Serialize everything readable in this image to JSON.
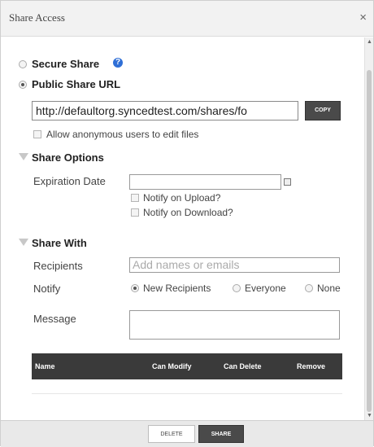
{
  "dialog": {
    "title": "Share Access",
    "close_glyph": "×"
  },
  "share_type": {
    "secure_label": "Secure Share",
    "public_label": "Public Share URL",
    "selected": "public"
  },
  "public_url": {
    "value": "http://defaultorg.syncedtest.com/shares/fo",
    "copy_label": "COPY",
    "anonymous_edit_label": "Allow anonymous users to edit files",
    "anonymous_edit_checked": false
  },
  "share_options": {
    "heading": "Share Options",
    "expiration_label": "Expiration Date",
    "expiration_value": "",
    "notify_upload_label": "Notify on Upload?",
    "notify_download_label": "Notify on Download?"
  },
  "share_with": {
    "heading": "Share With",
    "recipients_label": "Recipients",
    "recipients_placeholder": "Add names or emails",
    "notify_label": "Notify",
    "notify_options": [
      "New Recipients",
      "Everyone",
      "None"
    ],
    "notify_selected": "New Recipients",
    "message_label": "Message",
    "message_value": ""
  },
  "table": {
    "columns": [
      "Name",
      "Can Modify",
      "Can Delete",
      "Remove"
    ]
  },
  "footer": {
    "delete_label": "DELETE",
    "share_label": "SHARE"
  },
  "icons": {
    "info": "info-icon",
    "calendar": "calendar-icon",
    "close": "close-icon",
    "collapse": "collapse-triangle-icon"
  },
  "colors": {
    "accent_info": "#2f6fd6",
    "dark_button": "#4a4a4a",
    "table_header": "#3a3a3a"
  }
}
